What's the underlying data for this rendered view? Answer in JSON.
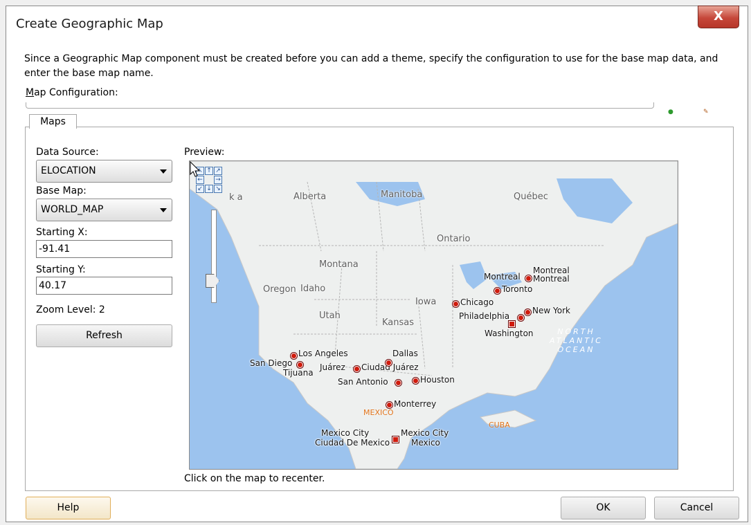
{
  "window": {
    "title": "Create Geographic Map",
    "close_glyph": "X"
  },
  "description": "Since a Geographic Map component must be created before you can add a theme, specify the configuration to use for the base map data, and enter the base map name.",
  "map_configuration": {
    "label": "Map Configuration:",
    "value": ""
  },
  "tabs": [
    {
      "label": "Maps",
      "selected": true
    }
  ],
  "form": {
    "data_source": {
      "label": "Data Source:",
      "value": "ELOCATION"
    },
    "base_map": {
      "label": "Base Map:",
      "value": "WORLD_MAP"
    },
    "starting_x": {
      "label": "Starting X:",
      "value": "-91.41"
    },
    "starting_y": {
      "label": "Starting Y:",
      "value": "40.17"
    },
    "zoom_level": "Zoom Level: 2",
    "refresh_label": "Refresh"
  },
  "preview": {
    "label": "Preview:",
    "hint": "Click on the map to recenter.",
    "zoom_level": 2,
    "regions": [
      "Alberta",
      "Manitoba",
      "Québec",
      "Ontario",
      "Montana",
      "Oregon",
      "Idaho",
      "Iowa",
      "Utah",
      "Kansas",
      "k a"
    ],
    "ocean": [
      "NORTH",
      "ATLANTIC",
      "OCEAN"
    ],
    "countries": [
      "MEXICO",
      "CUBA"
    ],
    "cities": [
      "Montreal",
      "Montreal",
      "Montreal",
      "Toronto",
      "Chicago",
      "New York",
      "Philadelphia",
      "Washington",
      "Los Angeles",
      "San Diego",
      "Tijuana",
      "Juárez",
      "Ciudad Juárez",
      "Dallas",
      "San Antonio",
      "Houston",
      "Monterrey",
      "Mexico City",
      "Ciudad De Mexico",
      "Mexico City",
      "Mexico"
    ]
  },
  "footer": {
    "help_label": "Help",
    "ok_label": "OK",
    "cancel_label": "Cancel"
  }
}
